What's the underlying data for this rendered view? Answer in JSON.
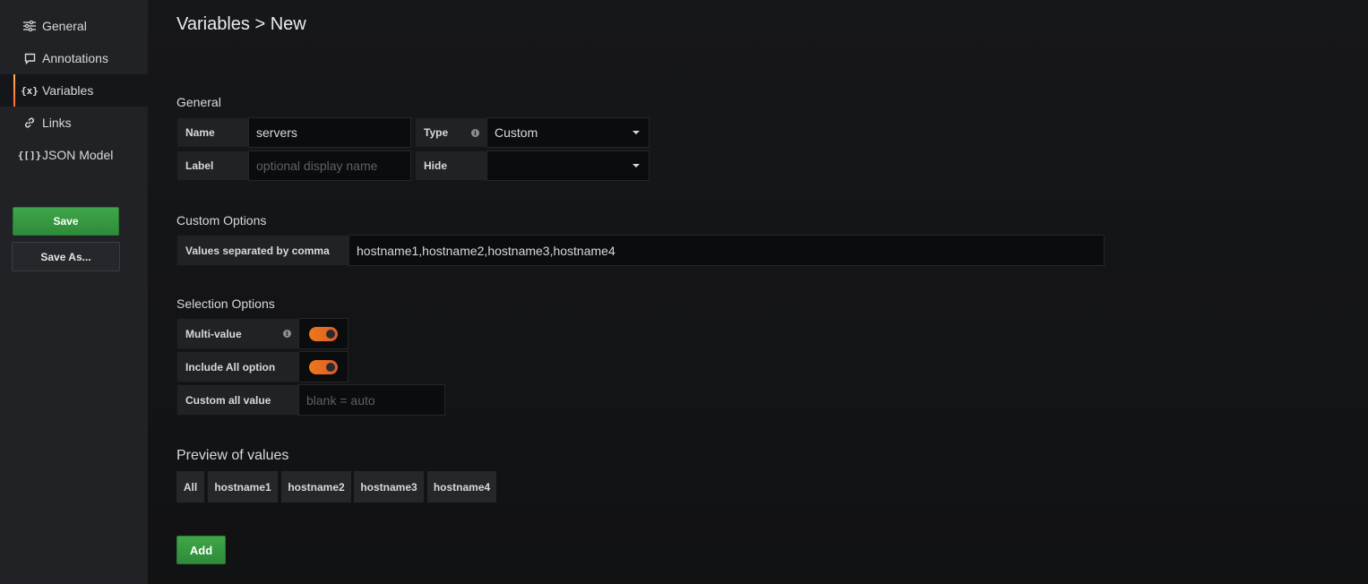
{
  "sidebar": {
    "items": [
      {
        "label": "General",
        "icon": "sliders-icon"
      },
      {
        "label": "Annotations",
        "icon": "comment-icon"
      },
      {
        "label": "Variables",
        "icon": "variable-icon",
        "active": true
      },
      {
        "label": "Links",
        "icon": "link-icon"
      },
      {
        "label": "JSON Model",
        "icon": "json-icon"
      }
    ],
    "save_label": "Save",
    "save_as_label": "Save As..."
  },
  "page": {
    "title": "Variables > New"
  },
  "general": {
    "section_title": "General",
    "name_label": "Name",
    "name_value": "servers",
    "type_label": "Type",
    "type_value": "Custom",
    "label_label": "Label",
    "label_placeholder": "optional display name",
    "hide_label": "Hide",
    "hide_value": ""
  },
  "custom_options": {
    "section_title": "Custom Options",
    "values_label": "Values separated by comma",
    "values_value": "hostname1,hostname2,hostname3,hostname4"
  },
  "selection_options": {
    "section_title": "Selection Options",
    "multi_value_label": "Multi-value",
    "multi_value_enabled": true,
    "include_all_label": "Include All option",
    "include_all_enabled": true,
    "custom_all_label": "Custom all value",
    "custom_all_placeholder": "blank = auto"
  },
  "preview": {
    "section_title": "Preview of values",
    "values": [
      "All",
      "hostname1",
      "hostname2",
      "hostname3",
      "hostname4"
    ]
  },
  "actions": {
    "add_label": "Add"
  },
  "colors": {
    "accent_green": "#3fa64a",
    "toggle_orange": "#eb7b18",
    "active_indicator": "#ff8833"
  }
}
